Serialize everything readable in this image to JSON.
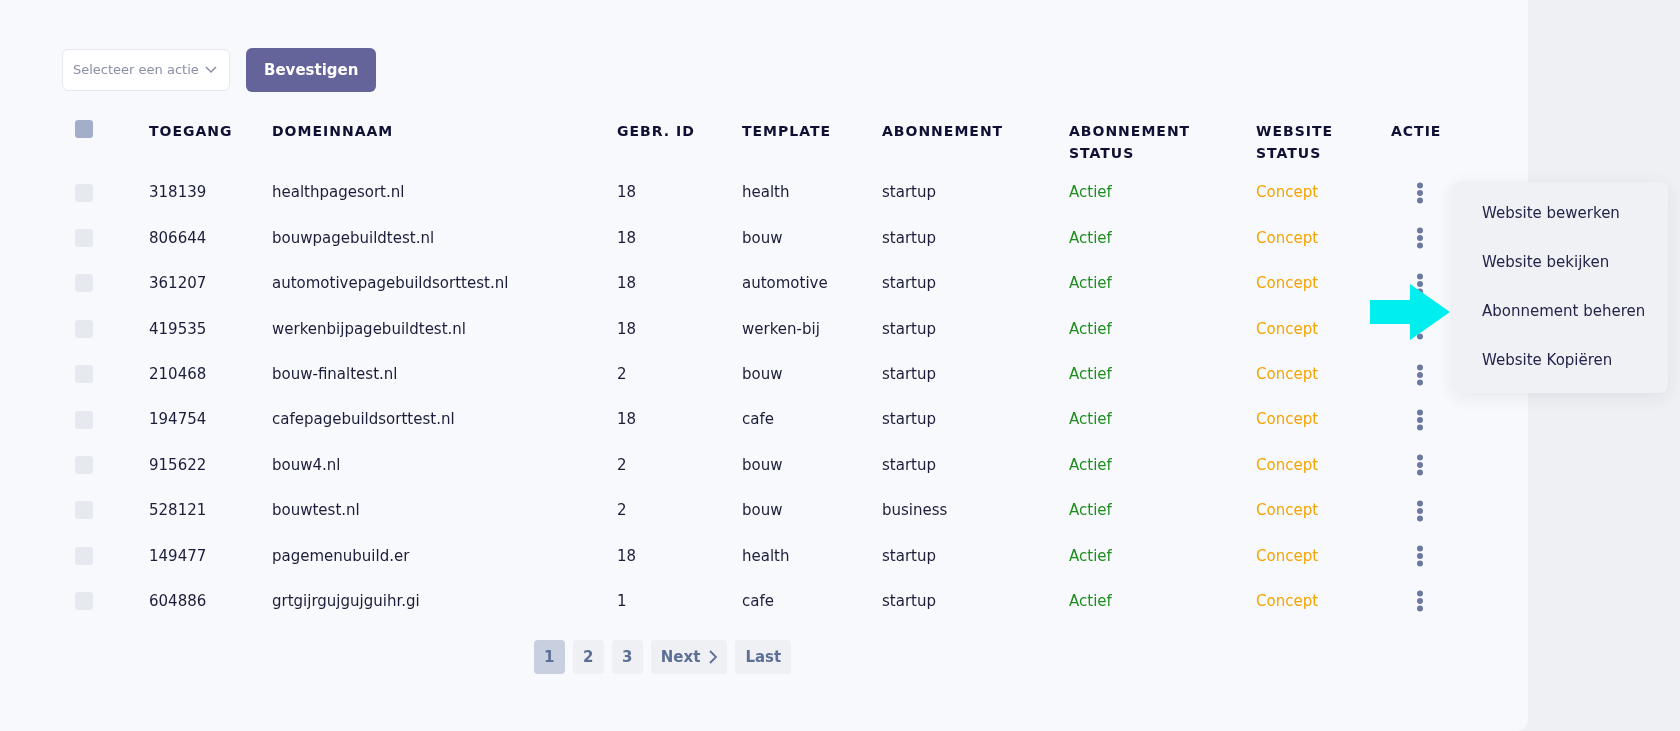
{
  "bulk_action": {
    "placeholder": "Selecteer een actie",
    "button": "Bevestigen"
  },
  "table": {
    "header_checkbox": {
      "checked": false
    },
    "columns": [
      "TOEGANG",
      "DOMEINNAAM",
      "GEBR. ID",
      "TEMPLATE",
      "ABONNEMENT",
      "ABONNEMENT STATUS",
      "WEBSITE STATUS",
      "ACTIE"
    ],
    "rows": [
      {
        "checked": false,
        "access": "318139",
        "domain": "healthpagesort.nl",
        "user_id": "18",
        "template": "health",
        "subscription": "startup",
        "subscription_status": "Actief",
        "website_status": "Concept"
      },
      {
        "checked": false,
        "access": "806644",
        "domain": "bouwpagebuildtest.nl",
        "user_id": "18",
        "template": "bouw",
        "subscription": "startup",
        "subscription_status": "Actief",
        "website_status": "Concept"
      },
      {
        "checked": false,
        "access": "361207",
        "domain": "automotivepagebuildsorttest.nl",
        "user_id": "18",
        "template": "automotive",
        "subscription": "startup",
        "subscription_status": "Actief",
        "website_status": "Concept"
      },
      {
        "checked": false,
        "access": "419535",
        "domain": "werkenbijpagebuildtest.nl",
        "user_id": "18",
        "template": "werken-bij",
        "subscription": "startup",
        "subscription_status": "Actief",
        "website_status": "Concept"
      },
      {
        "checked": false,
        "access": "210468",
        "domain": "bouw-finaltest.nl",
        "user_id": "2",
        "template": "bouw",
        "subscription": "startup",
        "subscription_status": "Actief",
        "website_status": "Concept"
      },
      {
        "checked": false,
        "access": "194754",
        "domain": "cafepagebuildsorttest.nl",
        "user_id": "18",
        "template": "cafe",
        "subscription": "startup",
        "subscription_status": "Actief",
        "website_status": "Concept"
      },
      {
        "checked": false,
        "access": "915622",
        "domain": "bouw4.nl",
        "user_id": "2",
        "template": "bouw",
        "subscription": "startup",
        "subscription_status": "Actief",
        "website_status": "Concept"
      },
      {
        "checked": false,
        "access": "528121",
        "domain": "bouwtest.nl",
        "user_id": "2",
        "template": "bouw",
        "subscription": "business",
        "subscription_status": "Actief",
        "website_status": "Concept"
      },
      {
        "checked": false,
        "access": "149477",
        "domain": "pagemenubuild.er",
        "user_id": "18",
        "template": "health",
        "subscription": "startup",
        "subscription_status": "Actief",
        "website_status": "Concept"
      },
      {
        "checked": false,
        "access": "604886",
        "domain": "grtgijrgujgujguihr.gi",
        "user_id": "1",
        "template": "cafe",
        "subscription": "startup",
        "subscription_status": "Actief",
        "website_status": "Concept"
      }
    ]
  },
  "action_menu": {
    "items": [
      "Website bewerken",
      "Website bekijken",
      "Abonnement beheren",
      "Website Kopiëren"
    ]
  },
  "pagination": {
    "pages": [
      {
        "label": "1",
        "selected": true
      },
      {
        "label": "2",
        "selected": false
      },
      {
        "label": "3",
        "selected": false
      }
    ],
    "next": "Next",
    "last": "Last"
  }
}
